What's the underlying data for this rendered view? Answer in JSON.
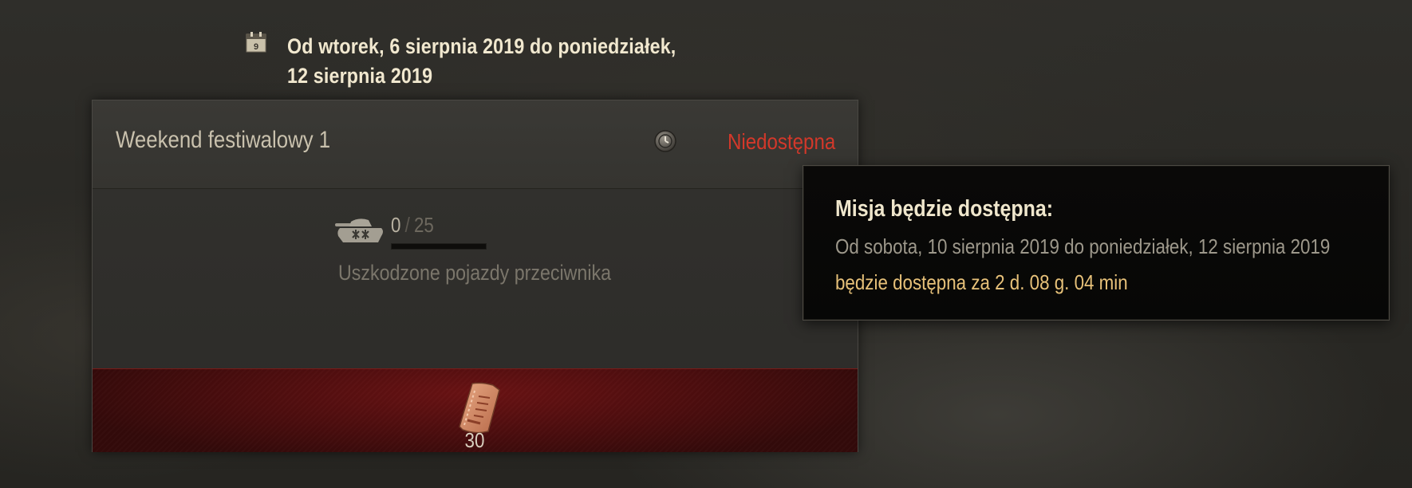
{
  "header": {
    "date_line_1": "Od wtorek, 6 sierpnia 2019 do poniedziałek,",
    "date_line_2": "12 sierpnia 2019",
    "calendar_day": "9"
  },
  "mission": {
    "title": "Weekend festiwalowy 1",
    "status": "Niedostępna",
    "progress_current": "0",
    "progress_separator": "/",
    "progress_total": "25",
    "progress_fraction": 0,
    "objective": "Uszkodzone pojazdy przeciwnika",
    "reward_count": "30"
  },
  "tooltip": {
    "title": "Misja będzie dostępna:",
    "dates": "Od sobota, 10 sierpnia 2019 do poniedziałek, 12 sierpnia 2019",
    "countdown": "będzie dostępna za 2 d. 08 g. 04 min"
  },
  "icons": {
    "calendar": "calendar-icon",
    "lock": "lock-clock-icon",
    "tank": "tank-icon",
    "reward": "ticket-icon"
  },
  "colors": {
    "status_unavailable": "#d3382a",
    "countdown": "#e7c179",
    "reward_strip": "#5a0f10"
  }
}
